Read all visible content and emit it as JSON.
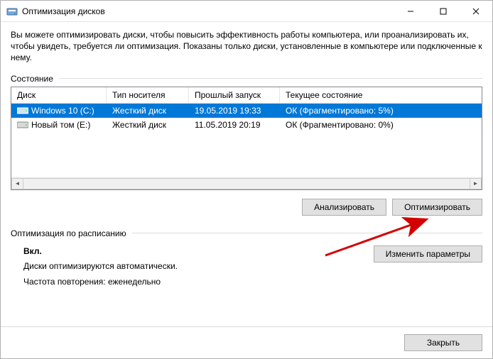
{
  "window": {
    "title": "Оптимизация дисков"
  },
  "intro": "Вы можете оптимизировать диски, чтобы повысить эффективность работы компьютера, или проанализировать их, чтобы увидеть, требуется ли оптимизация. Показаны только диски, установленные в компьютере или подключенные к нему.",
  "status_label": "Состояние",
  "columns": {
    "disk": "Диск",
    "media": "Тип носителя",
    "last": "Прошлый запуск",
    "state": "Текущее состояние"
  },
  "rows": [
    {
      "name": "Windows 10 (C:)",
      "media": "Жесткий диск",
      "last": "19.05.2019 19:33",
      "state": "ОК (Фрагментировано: 5%)",
      "selected": true
    },
    {
      "name": "Новый том (E:)",
      "media": "Жесткий диск",
      "last": "11.05.2019 20:19",
      "state": "ОК (Фрагментировано: 0%)",
      "selected": false
    }
  ],
  "buttons": {
    "analyze": "Анализировать",
    "optimize": "Оптимизировать",
    "change": "Изменить параметры",
    "close": "Закрыть"
  },
  "schedule": {
    "label": "Оптимизация по расписанию",
    "status": "Вкл.",
    "line1": "Диски оптимизируются автоматически.",
    "line2": "Частота повторения: еженедельно"
  }
}
